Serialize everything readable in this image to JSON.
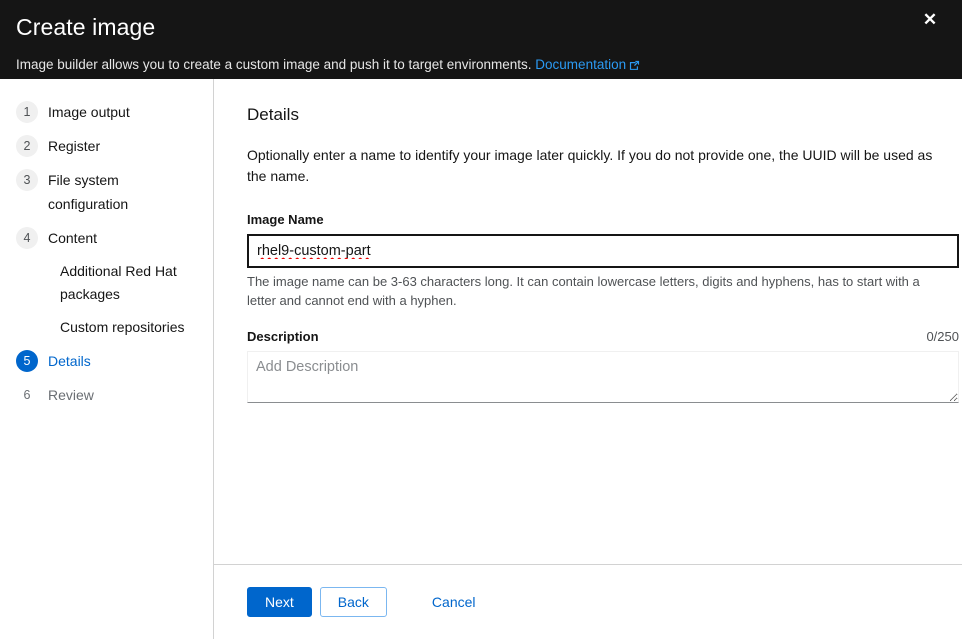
{
  "header": {
    "title": "Create image",
    "description_prefix": "Image builder allows you to create a custom image and push it to target environments.",
    "documentation_link": "Documentation",
    "close_label": "✕",
    "background_color": "#151515",
    "link_color": "#2b9af3"
  },
  "nav": {
    "items": [
      {
        "number": "1",
        "label": "Image output",
        "state": "default"
      },
      {
        "number": "2",
        "label": "Register",
        "state": "default"
      },
      {
        "number": "3",
        "label": "File system configuration",
        "state": "default"
      },
      {
        "number": "4",
        "label": "Content",
        "state": "default"
      },
      {
        "number": "5",
        "label": "Details",
        "state": "active"
      },
      {
        "number": "6",
        "label": "Review",
        "state": "plain"
      }
    ],
    "sub_items": [
      {
        "label": "Additional Red Hat packages"
      },
      {
        "label": "Custom repositories"
      }
    ],
    "active_color": "#0066cc"
  },
  "main": {
    "section_title": "Details",
    "section_description": "Optionally enter a name to identify your image later quickly. If you do not provide one, the UUID will be used as the name.",
    "image_name": {
      "label": "Image Name",
      "value": "rhel9-custom-part",
      "placeholder": "",
      "hint": "The image name can be 3-63 characters long. It can contain lowercase letters, digits and hyphens, has to start with a letter and cannot end with a hyphen.",
      "focused": true,
      "spellcheck_error": true
    },
    "description": {
      "label": "Description",
      "value": "",
      "placeholder": "Add Description",
      "char_count": "0/250",
      "max_length": 250
    }
  },
  "footer": {
    "next_label": "Next",
    "back_label": "Back",
    "cancel_label": "Cancel",
    "primary_color": "#0066cc"
  }
}
